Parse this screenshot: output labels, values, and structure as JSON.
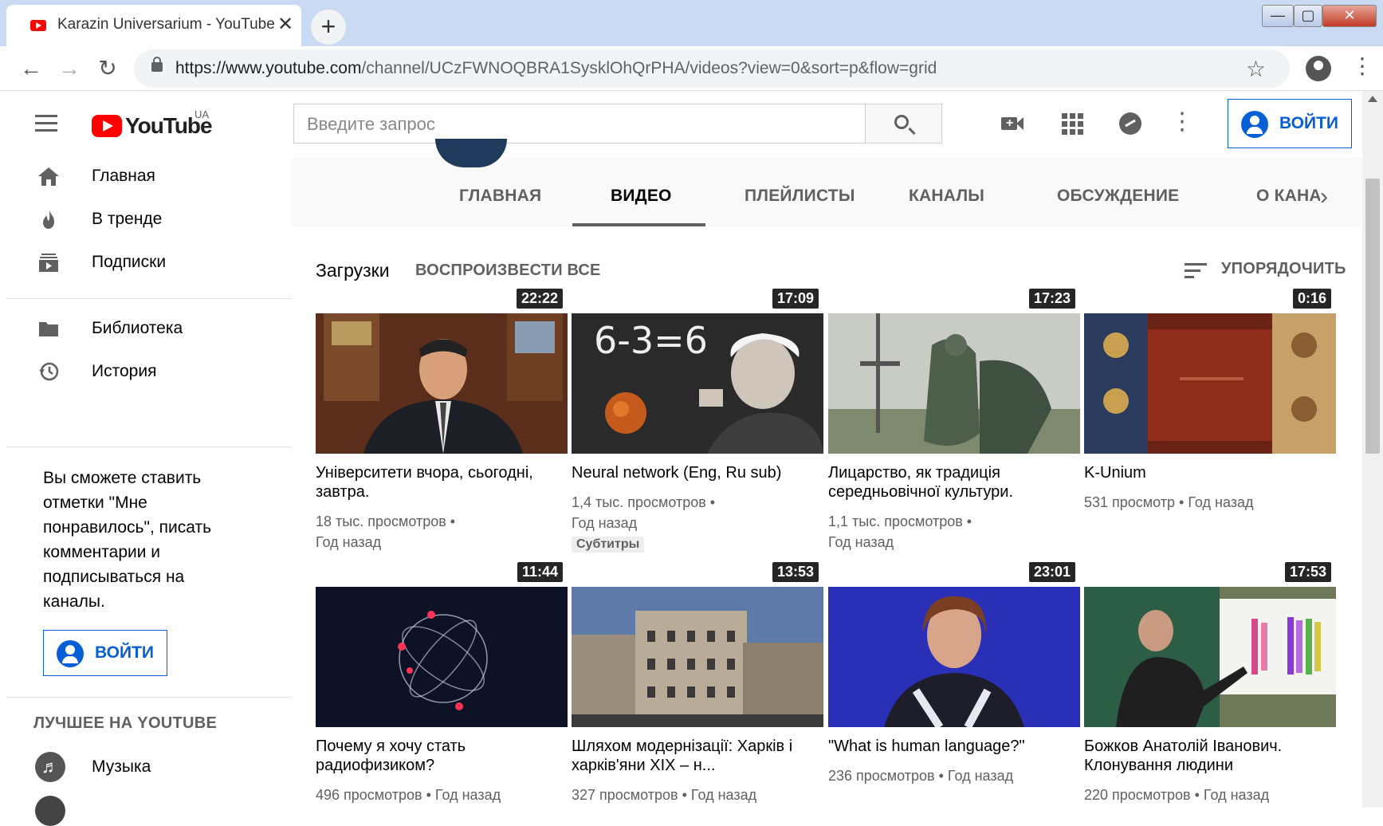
{
  "browser": {
    "tab_title": "Karazin Universarium - YouTube",
    "tab_close": "✕",
    "new_tab": "+",
    "url_host": "https://www.youtube.com",
    "url_path": "/channel/UCzFWNOQBRA1SysklOhQrPHA/videos?view=0&sort=p&flow=grid",
    "back": "←",
    "forward": "→",
    "reload": "↻",
    "star": "☆",
    "menu": "⋮",
    "win_min": "—",
    "win_max": "▢",
    "win_close": "✕"
  },
  "header": {
    "logo_text": "YouTube",
    "country": "UA",
    "search_placeholder": "Введите запрос",
    "more": "⋮",
    "signin_label": "ВОЙТИ"
  },
  "sidebar": {
    "items": [
      {
        "label": "Главная",
        "icon": "home-icon"
      },
      {
        "label": "В тренде",
        "icon": "trending-icon"
      },
      {
        "label": "Подписки",
        "icon": "subscriptions-icon"
      },
      {
        "label": "Библиотека",
        "icon": "library-icon"
      },
      {
        "label": "История",
        "icon": "history-icon"
      }
    ],
    "promo_text": "Вы сможете ставить отметки \"Мне понравилось\", писать комментарии и подписываться на каналы.",
    "signin_label": "ВОЙТИ",
    "best_heading": "ЛУЧШЕЕ НА YOUTUBE",
    "music_label": "Музыка",
    "music_glyph": "♬"
  },
  "channel": {
    "tabs": [
      "ГЛАВНАЯ",
      "ВИДЕО",
      "ПЛЕЙЛИСТЫ",
      "КАНАЛЫ",
      "ОБСУЖДЕНИЕ",
      "О КАНАЛЕ"
    ],
    "active_tab": "ВИДЕО",
    "next": "›",
    "uploads_label": "Загрузки",
    "play_all_label": "ВОСПРОИЗВЕСТИ ВСЕ",
    "sort_label": "УПОРЯДОЧИТЬ"
  },
  "videos": [
    {
      "title": "Університети вчора, сьогодні, завтра.",
      "duration": "22:22",
      "meta1": "18 тыс. просмотров •",
      "meta2": "Год назад"
    },
    {
      "title": "Neural network (Eng, Ru sub)",
      "duration": "17:09",
      "meta1": "1,4 тыс. просмотров •",
      "meta2": "Год назад",
      "badge": "Субтитры"
    },
    {
      "title": "Лицарство, як традиція середньовічної культури.",
      "duration": "17:23",
      "meta1": "1,1 тыс. просмотров •",
      "meta2": "Год назад"
    },
    {
      "title": "K-Unium",
      "duration": "0:16",
      "meta1": "531 просмотр • Год назад",
      "meta2": ""
    },
    {
      "title": "Почему я хочу стать радиофизиком?",
      "duration": "11:44",
      "meta1": "496 просмотров • Год назад",
      "meta2": ""
    },
    {
      "title": "Шляхом модернізації: Харків і харків'яни XIX – н...",
      "duration": "13:53",
      "meta1": "327 просмотров • Год назад",
      "meta2": ""
    },
    {
      "title": "\"What is human language?\"",
      "duration": "23:01",
      "meta1": "236 просмотров • Год назад",
      "meta2": ""
    },
    {
      "title": "Божков Анатолій Іванович. Клонування людини",
      "duration": "17:53",
      "meta1": "220 просмотров • Год назад",
      "meta2": ""
    }
  ],
  "colors": {
    "brand_red": "#ff0000",
    "accent_blue": "#065fd4",
    "text_secondary": "#606060"
  }
}
